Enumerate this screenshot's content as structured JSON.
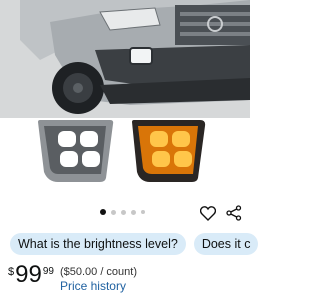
{
  "product": {
    "image_alt": "Toyota truck front with LED fog lights",
    "carousel": {
      "total": 5,
      "active_index": 0
    }
  },
  "actions": {
    "wishlist_icon": "heart-outline-icon",
    "share_icon": "share-icon"
  },
  "questions": [
    {
      "label": "What is the brightness level?"
    },
    {
      "label": "Does it c"
    }
  ],
  "price": {
    "currency": "$",
    "whole": "99",
    "cents": "99",
    "unit_price": "($50.00 / count)",
    "history_link": "Price history"
  },
  "colors": {
    "chip_bg": "#d9ebf8",
    "link": "#2162a1",
    "amber_light": "#f39a1c"
  }
}
